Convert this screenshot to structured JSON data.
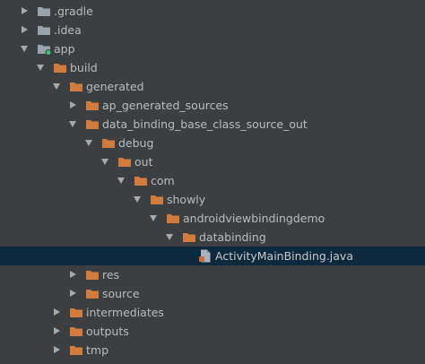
{
  "colors": {
    "background": "#3c3f41",
    "selection": "#0d293e",
    "folder_orange": "#d17b3c",
    "folder_gray": "#9aa3ab",
    "text": "#bbbbbb",
    "module_dot": "#3ec46d"
  },
  "tree": [
    {
      "label": ".gradle",
      "depth": 0,
      "expanded": false,
      "icon": "folder-gray-icon"
    },
    {
      "label": ".idea",
      "depth": 0,
      "expanded": false,
      "icon": "folder-gray-icon"
    },
    {
      "label": "app",
      "depth": 0,
      "expanded": true,
      "icon": "module-folder-icon"
    },
    {
      "label": "build",
      "depth": 1,
      "expanded": true,
      "icon": "folder-orange-icon"
    },
    {
      "label": "generated",
      "depth": 2,
      "expanded": true,
      "icon": "folder-orange-icon"
    },
    {
      "label": "ap_generated_sources",
      "depth": 3,
      "expanded": false,
      "icon": "folder-orange-icon"
    },
    {
      "label": "data_binding_base_class_source_out",
      "depth": 3,
      "expanded": true,
      "icon": "folder-orange-icon"
    },
    {
      "label": "debug",
      "depth": 4,
      "expanded": true,
      "icon": "folder-orange-icon"
    },
    {
      "label": "out",
      "depth": 5,
      "expanded": true,
      "icon": "folder-orange-icon"
    },
    {
      "label": "com",
      "depth": 6,
      "expanded": true,
      "icon": "folder-orange-icon"
    },
    {
      "label": "showly",
      "depth": 7,
      "expanded": true,
      "icon": "folder-orange-icon"
    },
    {
      "label": "androidviewbindingdemo",
      "depth": 8,
      "expanded": true,
      "icon": "folder-orange-icon"
    },
    {
      "label": "databinding",
      "depth": 9,
      "expanded": true,
      "icon": "folder-orange-icon"
    },
    {
      "label": "ActivityMainBinding.java",
      "depth": 10,
      "expanded": null,
      "icon": "java-file-icon",
      "selected": true
    },
    {
      "label": "res",
      "depth": 3,
      "expanded": false,
      "icon": "folder-orange-icon"
    },
    {
      "label": "source",
      "depth": 3,
      "expanded": false,
      "icon": "folder-orange-icon"
    },
    {
      "label": "intermediates",
      "depth": 2,
      "expanded": false,
      "icon": "folder-orange-icon"
    },
    {
      "label": "outputs",
      "depth": 2,
      "expanded": false,
      "icon": "folder-orange-icon"
    },
    {
      "label": "tmp",
      "depth": 2,
      "expanded": false,
      "icon": "folder-orange-icon"
    }
  ]
}
